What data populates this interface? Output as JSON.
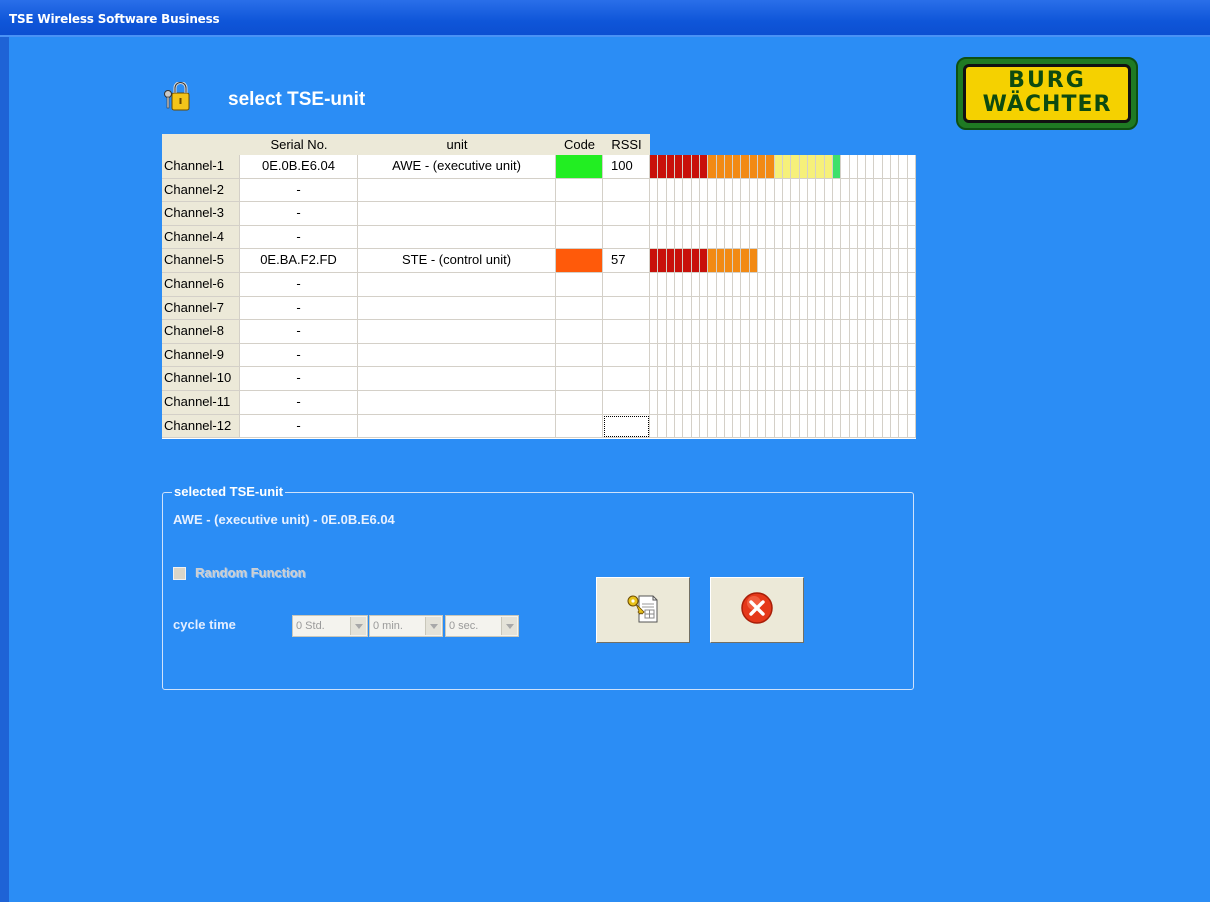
{
  "window": {
    "title": "TSE Wireless Software Business"
  },
  "page": {
    "heading": "select TSE-unit"
  },
  "logo": {
    "line1": "BURG",
    "line2": "WÄCHTER"
  },
  "table": {
    "columns": [
      "Serial No.",
      "unit",
      "Code",
      "RSSI"
    ],
    "rows": [
      {
        "channel": "Channel-1",
        "serial": "0E.0B.E6.04",
        "unit": "AWE - (executive unit)",
        "code_color": "#22ee22",
        "rssi": "100",
        "rssi_value": 100
      },
      {
        "channel": "Channel-2",
        "serial": "-",
        "unit": "",
        "code_color": "",
        "rssi": "",
        "rssi_value": 0
      },
      {
        "channel": "Channel-3",
        "serial": "-",
        "unit": "",
        "code_color": "",
        "rssi": "",
        "rssi_value": 0
      },
      {
        "channel": "Channel-4",
        "serial": "-",
        "unit": "",
        "code_color": "",
        "rssi": "",
        "rssi_value": 0
      },
      {
        "channel": "Channel-5",
        "serial": "0E.BA.F2.FD",
        "unit": "STE - (control unit)",
        "code_color": "#ff5a0a",
        "rssi": "57",
        "rssi_value": 57
      },
      {
        "channel": "Channel-6",
        "serial": "-",
        "unit": "",
        "code_color": "",
        "rssi": "",
        "rssi_value": 0
      },
      {
        "channel": "Channel-7",
        "serial": "-",
        "unit": "",
        "code_color": "",
        "rssi": "",
        "rssi_value": 0
      },
      {
        "channel": "Channel-8",
        "serial": "-",
        "unit": "",
        "code_color": "",
        "rssi": "",
        "rssi_value": 0
      },
      {
        "channel": "Channel-9",
        "serial": "-",
        "unit": "",
        "code_color": "",
        "rssi": "",
        "rssi_value": 0
      },
      {
        "channel": "Channel-10",
        "serial": "-",
        "unit": "",
        "code_color": "",
        "rssi": "",
        "rssi_value": 0
      },
      {
        "channel": "Channel-11",
        "serial": "-",
        "unit": "",
        "code_color": "",
        "rssi": "",
        "rssi_value": 0
      },
      {
        "channel": "Channel-12",
        "serial": "-",
        "unit": "",
        "code_color": "",
        "rssi": "",
        "rssi_value": 0
      }
    ]
  },
  "selected": {
    "legend": "selected TSE-unit",
    "text": "AWE - (executive unit) - 0E.0B.E6.04",
    "random_function_label": "Random Function",
    "random_function_checked": false,
    "cycle_time_label": "cycle time",
    "hours": "0 Std.",
    "minutes": "0 min.",
    "seconds": "0 sec."
  },
  "buttons": {
    "confirm_icon": "key-document-icon",
    "cancel_icon": "cancel-x-icon"
  },
  "colors": {
    "background": "#2b8df5",
    "titlebar": "#0f56d9",
    "rssi_red": "#c8100a",
    "rssi_orange": "#f28a14",
    "rssi_yellow": "#f6f07a",
    "rssi_green": "#3ee06a"
  }
}
